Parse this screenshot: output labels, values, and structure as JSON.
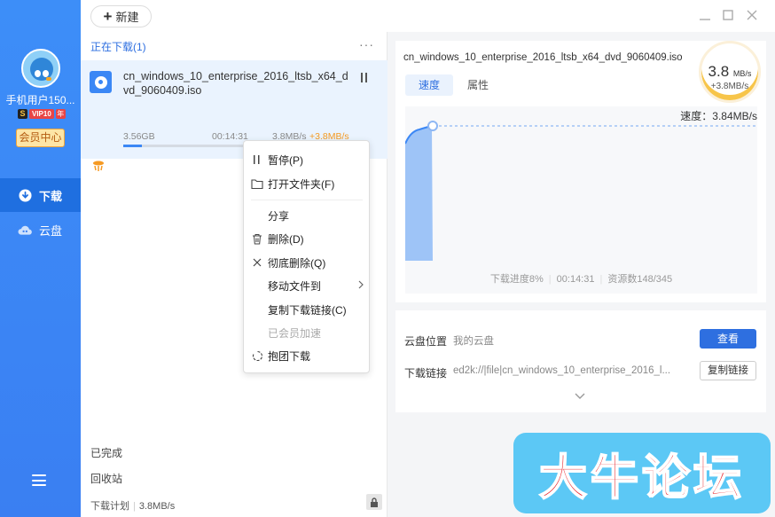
{
  "user": {
    "name": "手机用户150...",
    "vip_s": "S",
    "vip_label": "VIP10",
    "vip_year": "年",
    "member_center": "会员中心"
  },
  "nav": {
    "items": [
      {
        "label": "下载",
        "icon": "download-icon",
        "active": true
      },
      {
        "label": "云盘",
        "icon": "cloud-icon",
        "active": false
      }
    ]
  },
  "toolbar": {
    "new_label": "新建"
  },
  "list": {
    "header": "正在下载(1)",
    "more": "···",
    "item": {
      "name": "cn_windows_10_enterprise_2016_ltsb_x64_dvd_9060409.iso",
      "size": "3.56GB",
      "time_left": "00:14:31",
      "speed": "3.8MB/s",
      "boost": "+3.8MB/s",
      "progress_percent": 8
    },
    "completed": "已完成",
    "recycle": "回收站",
    "plan_label": "下载计划",
    "plan_speed": "3.8MB/s"
  },
  "context_menu": {
    "items": [
      {
        "label": "暂停(P)",
        "icon": "pause-icon",
        "disabled": false
      },
      {
        "label": "打开文件夹(F)",
        "icon": "folder-icon",
        "disabled": false
      },
      {
        "label": "分享",
        "icon": "",
        "disabled": false
      },
      {
        "label": "删除(D)",
        "icon": "trash-icon",
        "disabled": false
      },
      {
        "label": "彻底删除(Q)",
        "icon": "close-icon",
        "disabled": false
      },
      {
        "label": "移动文件到",
        "icon": "",
        "disabled": false,
        "submenu": true
      },
      {
        "label": "复制下载链接(C)",
        "icon": "",
        "disabled": false
      },
      {
        "label": "已会员加速",
        "icon": "",
        "disabled": true
      },
      {
        "label": "抱团下载",
        "icon": "group-icon",
        "disabled": false
      }
    ]
  },
  "detail": {
    "title": "cn_windows_10_enterprise_2016_ltsb_x64_dvd_9060409.iso",
    "tabs": [
      "速度",
      "属性"
    ],
    "speed_value": "3.8",
    "speed_unit": "MB/s",
    "speed_boost": "+3.8MB/s",
    "chart_label": "速度：3.84MB/s",
    "progress_text": "下载进度8%",
    "time_text": "00:14:31",
    "sources_text": "资源数148/345"
  },
  "cloud": {
    "location_label": "云盘位置",
    "location_value": "我的云盘",
    "view_button": "查看",
    "link_label": "下载链接",
    "link_value": "ed2k://|file|cn_windows_10_enterprise_2016_l...",
    "copy_button": "复制链接"
  },
  "watermark": "大牛论坛",
  "colors": {
    "accent": "#2e6fe0",
    "sidebar": "#3d8ef8",
    "boost": "#f59a23"
  }
}
